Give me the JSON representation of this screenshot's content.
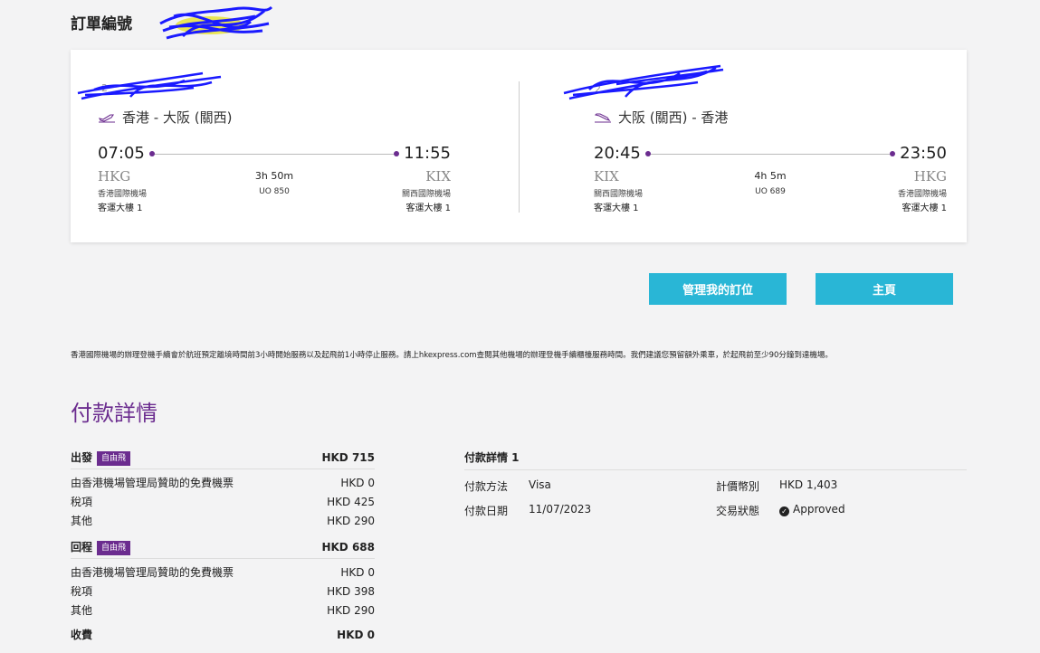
{
  "header": {
    "order_label": "訂單編號"
  },
  "flights": {
    "outbound": {
      "route": "香港 - 大阪 (關西)",
      "dep_time": "07:05",
      "arr_time": "11:55",
      "dep_code": "HKG",
      "arr_code": "KIX",
      "duration": "3h 50m",
      "flight_no": "UO 850",
      "dep_airport": "香港國際機場",
      "arr_airport": "關西國際機場",
      "dep_terminal": "客運大樓 1",
      "arr_terminal": "客運大樓 1"
    },
    "return": {
      "route": "大阪 (關西) - 香港",
      "dep_time": "20:45",
      "arr_time": "23:50",
      "dep_code": "KIX",
      "arr_code": "HKG",
      "duration": "4h 5m",
      "flight_no": "UO 689",
      "dep_airport": "關西國際機場",
      "arr_airport": "香港國際機場",
      "dep_terminal": "客運大樓 1",
      "arr_terminal": "客運大樓 1"
    }
  },
  "buttons": {
    "manage": "管理我的訂位",
    "home": "主頁"
  },
  "notice": "香港國際機場的辦理登機手續會於航班預定離境時間前3小時開始服務以及起飛前1小時停止服務。請上hkexpress.com查閱其他機場的辦理登機手續櫃檯服務時間。我們建議您預留額外乘車，於起飛前至少90分鐘到達機場。",
  "payment": {
    "title": "付款詳情",
    "fare_badge": "自由飛",
    "outbound": {
      "label": "出發",
      "total": "HKD 715",
      "items": [
        {
          "label": "由香港機場管理局贊助的免費機票",
          "value": "HKD 0"
        },
        {
          "label": "稅項",
          "value": "HKD 425"
        },
        {
          "label": "其他",
          "value": "HKD 290"
        }
      ]
    },
    "return": {
      "label": "回程",
      "total": "HKD 688",
      "items": [
        {
          "label": "由香港機場管理局贊助的免費機票",
          "value": "HKD 0"
        },
        {
          "label": "稅項",
          "value": "HKD 398"
        },
        {
          "label": "其他",
          "value": "HKD 290"
        }
      ]
    },
    "fees": {
      "label": "收費",
      "value": "HKD 0"
    },
    "details": {
      "heading": "付款詳情 1",
      "method_label": "付款方法",
      "method": "Visa",
      "date_label": "付款日期",
      "date": "11/07/2023",
      "currency_label": "計價幣別",
      "amount": "HKD 1,403",
      "status_label": "交易狀態",
      "status": "Approved"
    }
  },
  "colors": {
    "brand_purple": "#6b2c8f",
    "button_cyan": "#29b6d6",
    "redaction_blue": "#1a1aff"
  }
}
